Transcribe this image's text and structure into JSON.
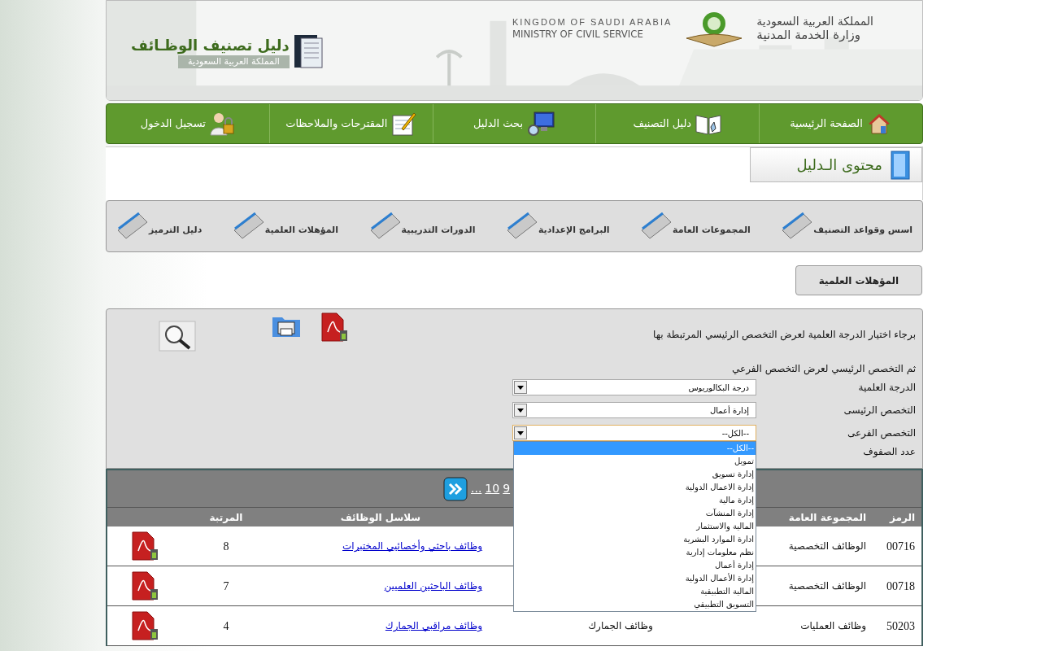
{
  "header": {
    "title": "دليل تصنيف الوظـائف",
    "subtitle": "المملكة العربية السعودية",
    "ministry_en": [
      "KINGDOM OF SAUDI ARABIA",
      "MINISTRY OF CIVIL SERVICE"
    ],
    "ministry_ar": [
      "المملكة العربية السعودية",
      "وزارة الخدمة المدنية"
    ]
  },
  "nav": [
    {
      "label": "الصفحة الرئيسية",
      "kind": "home"
    },
    {
      "label": "دليل التصنيف",
      "kind": "guide"
    },
    {
      "label": "بحث الدليل",
      "kind": "search"
    },
    {
      "label": "المقترحات والملاحظات",
      "kind": "notes"
    },
    {
      "label": "تسجيل الدخول",
      "kind": "login"
    }
  ],
  "content_title": "محتوى الـدليل",
  "tabs": [
    {
      "label": "اسس وقواعد التصنيف"
    },
    {
      "label": "المجموعات العامة"
    },
    {
      "label": "البرامج الإعدادية"
    },
    {
      "label": "الدورات التدريبية"
    },
    {
      "label": "المؤهلات العلمية"
    },
    {
      "label": "دليل الترميز"
    }
  ],
  "section_title": "المؤهلات العلمية",
  "form": {
    "instructions": [
      "برجاء اختيار الدرجة العلمية لعرض التخصص الرئيسي المرتبطة بها",
      "ثم التخصص الرئيسي لعرض التخصص الفرعي"
    ],
    "fields": [
      {
        "label": "الدرجة العلمية",
        "value": "درجة البكالوريوس",
        "open": false
      },
      {
        "label": "التخصص الرئيسى",
        "value": "إدارة أعمال",
        "open": false
      },
      {
        "label": "التخصص الفرعى",
        "value": "--الكل--",
        "open": true
      }
    ],
    "rows_label": "عدد الصفوف",
    "options": [
      {
        "label": "--الكل--",
        "selected": true
      },
      {
        "label": "تمويل",
        "selected": false
      },
      {
        "label": "إدارة تسويق",
        "selected": false
      },
      {
        "label": "إدارة الاعمال الدولية",
        "selected": false
      },
      {
        "label": "إدارة مالية",
        "selected": false
      },
      {
        "label": "إدارة المنشآت",
        "selected": false
      },
      {
        "label": "المالية والاستثمار",
        "selected": false
      },
      {
        "label": "ادارة الموارد البشرية",
        "selected": false
      },
      {
        "label": "نظم معلومات إدارية",
        "selected": false
      },
      {
        "label": "إدارة أعمال",
        "selected": false
      },
      {
        "label": "إدارة الأعمال الدولية",
        "selected": false
      },
      {
        "label": "المالية التطبيقية",
        "selected": false
      },
      {
        "label": "التسويق التطبيقي",
        "selected": false
      }
    ]
  },
  "pagination": {
    "pages": [
      "9",
      "10"
    ],
    "ellipsis": "..."
  },
  "table": {
    "columns": [
      "الرمز",
      "المجموعة العامة",
      "سلاسل الوظائف",
      "المرتبة"
    ],
    "rows": [
      {
        "code": "00716",
        "group": "الوظائف التخصصية",
        "series": "وظائف باحثي وأخصائيي المختبرات",
        "grade": "8"
      },
      {
        "code": "00718",
        "group": "الوظائف التخصصية",
        "series": "وظائف الباحثين العلميين",
        "grade": "7"
      },
      {
        "code": "50203",
        "group": "وظائف العمليات",
        "column_3": "وظائف الجمارك",
        "series": "وظائف مراقبي الجمارك",
        "grade": "4"
      }
    ]
  }
}
